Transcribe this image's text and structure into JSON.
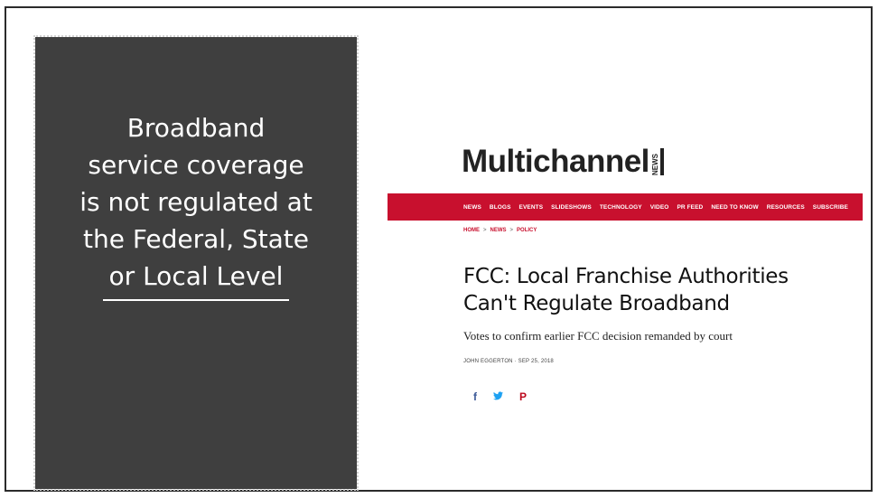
{
  "slide": {
    "panel_text_lines": [
      "Broadband",
      "service coverage",
      "is not regulated at",
      "the Federal, State",
      "or Local Level"
    ]
  },
  "article": {
    "logo": "Multichannel",
    "logo_tag": "NEWS",
    "nav_items": [
      "NEWS",
      "BLOGS",
      "EVENTS",
      "SLIDESHOWS",
      "TECHNOLOGY",
      "VIDEO",
      "PR FEED",
      "NEED TO KNOW",
      "RESOURCES",
      "SUBSCRIBE"
    ],
    "breadcrumb": [
      "HOME",
      "NEWS",
      "POLICY"
    ],
    "breadcrumb_sep": ">",
    "headline_line1": "FCC: Local Franchise Authorities",
    "headline_line2": "Can't Regulate Broadband",
    "subhead": "Votes to confirm earlier FCC decision remanded by court",
    "byline": "JOHN EGGERTON · SEP 25, 2018",
    "share_icons": [
      {
        "name": "facebook-icon",
        "glyph": "f"
      },
      {
        "name": "twitter-icon",
        "glyph": "🐦"
      },
      {
        "name": "pinterest-icon",
        "glyph": "P"
      }
    ]
  },
  "colors": {
    "panel_bg": "#3f3f3f",
    "nav_red": "#c8102e"
  }
}
